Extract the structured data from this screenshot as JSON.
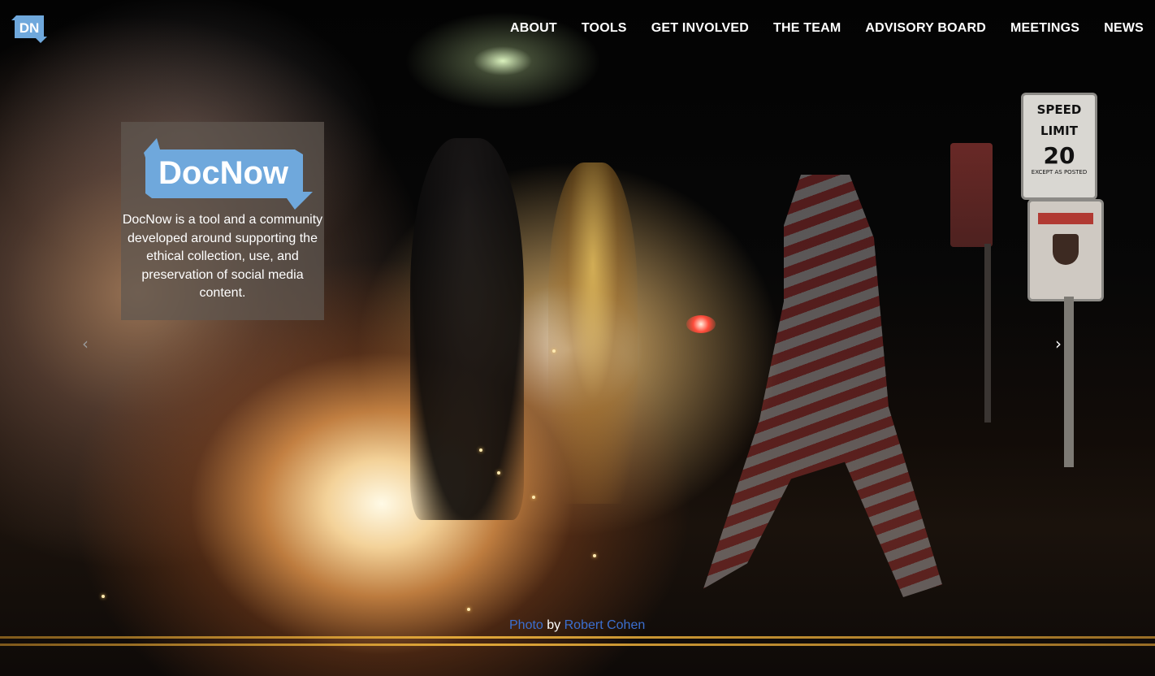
{
  "header": {
    "logo_text": "DN",
    "nav": [
      {
        "label": "ABOUT"
      },
      {
        "label": "TOOLS"
      },
      {
        "label": "GET INVOLVED"
      },
      {
        "label": "THE TEAM"
      },
      {
        "label": "ADVISORY BOARD"
      },
      {
        "label": "MEETINGS"
      },
      {
        "label": "NEWS"
      }
    ]
  },
  "intro": {
    "logo_text": "DocNow",
    "description": "DocNow is a tool and a community developed around supporting the ethical collection, use, and preservation of social media content."
  },
  "carousel": {
    "prev_icon": "chevron-left-icon",
    "next_icon": "chevron-right-icon",
    "prev_glyph": "‹",
    "next_glyph": "›"
  },
  "credit": {
    "photo_link": "Photo",
    "by": "by",
    "author_link": "Robert Cohen"
  },
  "scene_signs": {
    "speed_line1": "SPEED",
    "speed_line2": "LIMIT",
    "speed_value": "20",
    "speed_note": "EXCEPT AS POSTED"
  },
  "colors": {
    "brand_blue": "#6fa8dc",
    "link_blue": "#3b6fd0",
    "panel_bg": "rgba(95,88,80,0.72)"
  }
}
